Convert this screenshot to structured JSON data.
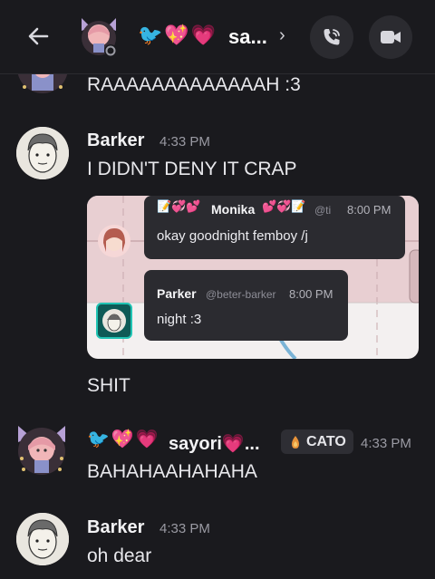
{
  "header": {
    "title": "sa...",
    "emoji_row": [
      "🐦",
      "💖",
      "💗"
    ]
  },
  "messages": [
    {
      "id": "m0",
      "text": "RAAAAAAAAAAAAAH :3"
    },
    {
      "id": "m1",
      "author": "Barker",
      "time": "4:33 PM",
      "text": "I DIDN'T DENY IT CRAP"
    },
    {
      "id": "m2",
      "text": "SHIT"
    },
    {
      "id": "m3",
      "author": "sayori💗...",
      "author_emojis": [
        "🐦",
        "💖",
        "💗"
      ],
      "badge": "CATO",
      "time": "4:33 PM",
      "text": "BAHAHAAHAHAHA"
    },
    {
      "id": "m4",
      "author": "Barker",
      "time": "4:33 PM",
      "text": "oh dear"
    }
  ],
  "embed": {
    "bubble1": {
      "emojis": "📝💞💕",
      "name": "Monika",
      "name_emojis": "💕💞📝",
      "handle": "@ti",
      "time": "8:00 PM",
      "text": "okay goodnight femboy /j"
    },
    "bubble2": {
      "name": "Parker",
      "handle": "@beter-barker",
      "time": "8:00 PM",
      "text": "night :3"
    }
  },
  "colors": {
    "background": "#1a1a1e",
    "header_button": "#2b2b30",
    "badge_bg": "#2e2e34",
    "timestamp": "#9a9aa3"
  }
}
